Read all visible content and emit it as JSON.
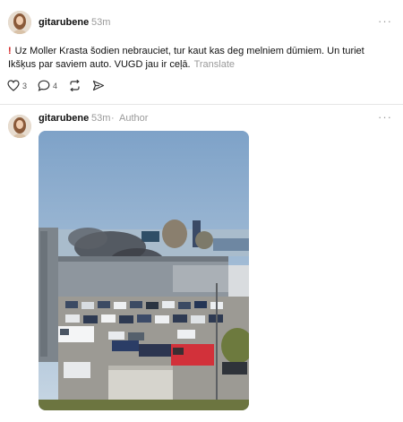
{
  "post1": {
    "username": "gitarubene",
    "time": "53m",
    "more_label": "···",
    "alert_mark": "!",
    "text": "Uz Moller Krasta šodien nebrauciet, tur kaut kas deg melniem dūmiem. Un turiet Ikšķus par saviem auto. VUGD jau ir ceļā.",
    "translate_label": "Translate",
    "like_count": "3",
    "comment_count": "4"
  },
  "post2": {
    "username": "gitarubene",
    "time": "53m",
    "separator": "·",
    "author_label": "Author",
    "more_label": "···"
  },
  "icons": [
    "heart-icon",
    "comment-icon",
    "repost-icon",
    "share-icon",
    "more-options-icon"
  ],
  "colors": {
    "alert": "#d32020",
    "muted": "#9a9a9a",
    "sky": "#9eb9d4"
  }
}
